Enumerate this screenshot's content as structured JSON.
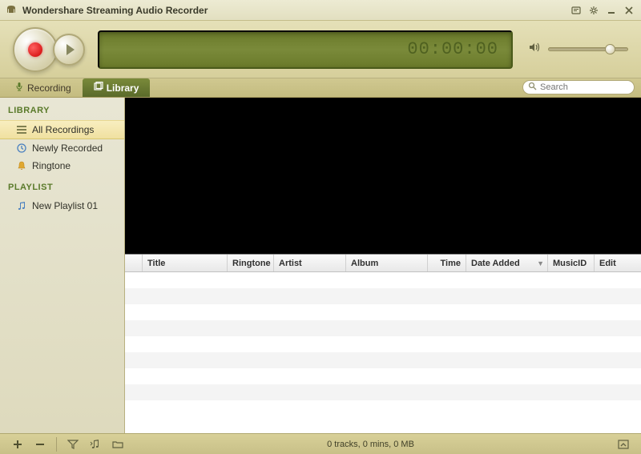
{
  "window": {
    "title": "Wondershare Streaming Audio Recorder"
  },
  "recorder": {
    "time_display": "00:00:00"
  },
  "tabs": {
    "recording": "Recording",
    "library": "Library"
  },
  "search": {
    "placeholder": "Search"
  },
  "sidebar": {
    "library_heading": "LIBRARY",
    "playlist_heading": "PLAYLIST",
    "items": {
      "all_recordings": "All Recordings",
      "newly_recorded": "Newly Recorded",
      "ringtone": "Ringtone"
    },
    "playlists": {
      "new_playlist": "New Playlist 01"
    }
  },
  "columns": {
    "title": "Title",
    "ringtone": "Ringtone",
    "artist": "Artist",
    "album": "Album",
    "time": "Time",
    "date_added": "Date Added",
    "musicid": "MusicID",
    "edit": "Edit"
  },
  "statusbar": {
    "summary": "0 tracks, 0 mins, 0 MB"
  }
}
